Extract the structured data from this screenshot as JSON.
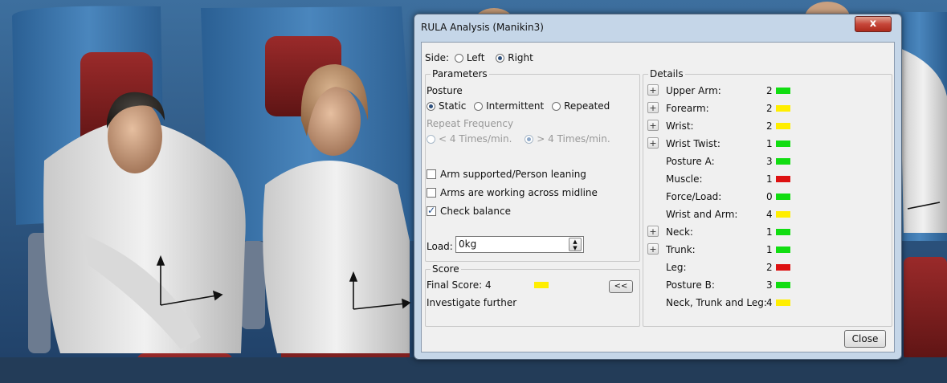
{
  "window": {
    "title": "RULA Analysis (Manikin3)",
    "close_glyph": "x"
  },
  "side": {
    "label": "Side:",
    "options": [
      "Left",
      "Right"
    ],
    "selected": "Right"
  },
  "parameters": {
    "title": "Parameters",
    "posture_label": "Posture",
    "posture_options": [
      "Static",
      "Intermittent",
      "Repeated"
    ],
    "posture_selected": "Static",
    "repeat_frequency_label": "Repeat Frequency",
    "repeat_options": [
      "< 4 Times/min.",
      "> 4 Times/min."
    ],
    "repeat_selected": "> 4 Times/min.",
    "checkboxes": [
      {
        "label": "Arm supported/Person leaning",
        "checked": false
      },
      {
        "label": "Arms are working across midline",
        "checked": false
      },
      {
        "label": "Check balance",
        "checked": true
      }
    ],
    "load_label": "Load:",
    "load_value": "0kg"
  },
  "score": {
    "title": "Score",
    "final_label": "Final Score: 4",
    "color": "#ffee00",
    "message": "Investigate further",
    "toggle_label": "<<"
  },
  "details": {
    "title": "Details",
    "colors": {
      "green": "#11dd11",
      "yellow": "#ffee00",
      "red": "#dd1111"
    },
    "rows": [
      {
        "label": "Upper Arm:",
        "value": "2",
        "color": "green",
        "expand": true
      },
      {
        "label": "Forearm:",
        "value": "2",
        "color": "yellow",
        "expand": true
      },
      {
        "label": "Wrist:",
        "value": "2",
        "color": "yellow",
        "expand": true
      },
      {
        "label": "Wrist Twist:",
        "value": "1",
        "color": "green",
        "expand": true
      },
      {
        "label": "Posture A:",
        "value": "3",
        "color": "green",
        "expand": false
      },
      {
        "label": "Muscle:",
        "value": "1",
        "color": "red",
        "expand": false
      },
      {
        "label": "Force/Load:",
        "value": "0",
        "color": "green",
        "expand": false
      },
      {
        "label": "Wrist and Arm:",
        "value": "4",
        "color": "yellow",
        "expand": false
      },
      {
        "label": "Neck:",
        "value": "1",
        "color": "green",
        "expand": true
      },
      {
        "label": "Trunk:",
        "value": "1",
        "color": "green",
        "expand": true
      },
      {
        "label": "Leg:",
        "value": "2",
        "color": "red",
        "expand": false
      },
      {
        "label": "Posture B:",
        "value": "3",
        "color": "green",
        "expand": false
      },
      {
        "label": "Neck, Trunk and Leg:",
        "value": "4",
        "color": "yellow",
        "expand": false
      }
    ],
    "expand_glyph": "+"
  },
  "buttons": {
    "close": "Close"
  }
}
